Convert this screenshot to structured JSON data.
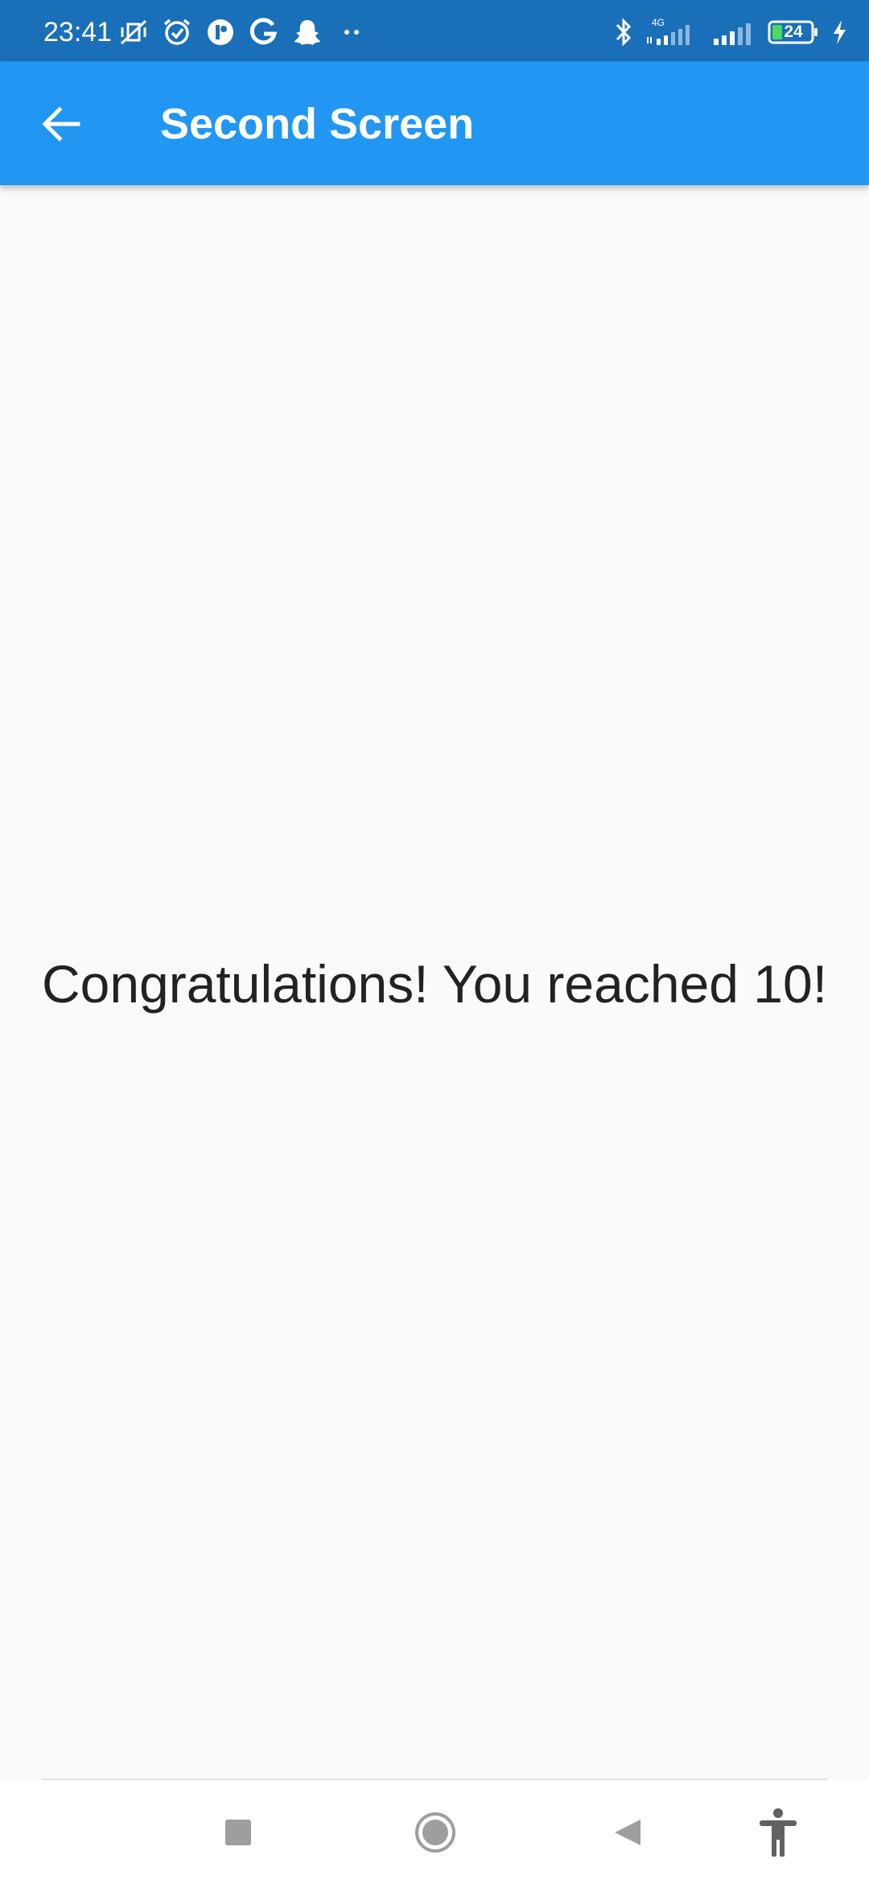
{
  "status_bar": {
    "time": "23:41",
    "network_type": "4G",
    "battery_level": "24",
    "color": "#1a6fb9",
    "left_icons": [
      "vibrate-off-icon",
      "alarm-icon",
      "app-notification-icon",
      "google-icon",
      "snapchat-icon",
      "more-dots-icon"
    ],
    "right_icons": [
      "bluetooth-icon",
      "signal-4g-icon",
      "signal-icon",
      "battery-icon",
      "charging-icon"
    ]
  },
  "app_bar": {
    "title": "Second Screen",
    "color": "#2196f3",
    "back_icon": "arrow-back-icon"
  },
  "main": {
    "message": "Congratulations! You reached 10!"
  },
  "nav_bar": {
    "buttons": [
      "recents-square-icon",
      "home-circle-icon",
      "back-triangle-icon",
      "accessibility-icon"
    ]
  }
}
